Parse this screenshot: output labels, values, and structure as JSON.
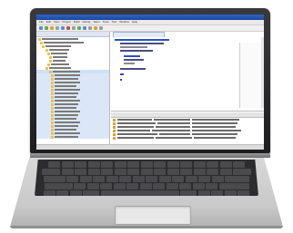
{
  "device": {
    "screen": {
      "menu": [
        "File",
        "Edit",
        "View",
        "Project",
        "Build",
        "Debug",
        "Team",
        "Tools",
        "Test",
        "Window",
        "Help"
      ],
      "colors": {
        "titlebar": "#2f66c4",
        "selection": "#cfe0f7",
        "panel_header": "#dfe6f2"
      }
    },
    "icons": {
      "tree_node": "folder-icon",
      "output_row": "warning-icon"
    }
  }
}
